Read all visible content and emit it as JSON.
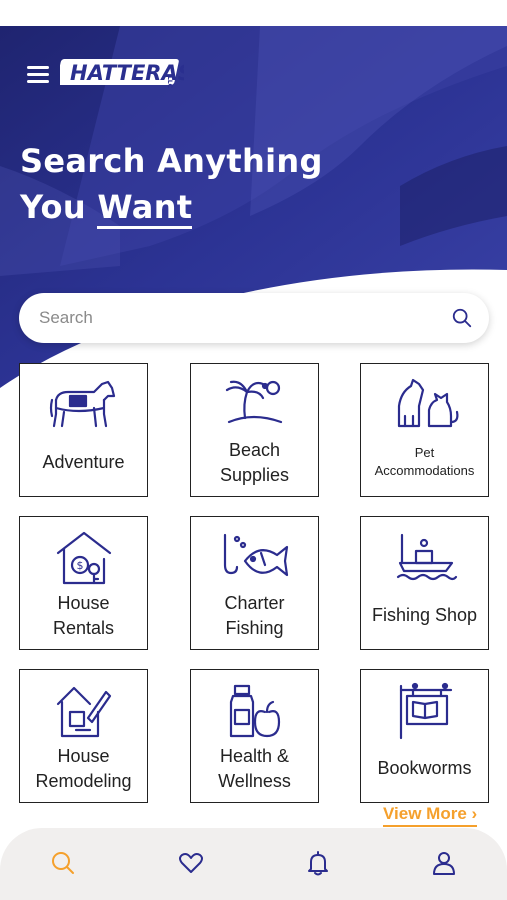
{
  "brand": {
    "logo_text": "HATTERAS",
    "logo_sub": "LLC"
  },
  "hero": {
    "title_line1": "Search Anything",
    "title_line2_a": "You ",
    "title_line2_b": "Want"
  },
  "search": {
    "placeholder": "Search"
  },
  "categories": [
    {
      "label": "Adventure",
      "icon": "horse-icon"
    },
    {
      "label": "Beach\nSupplies",
      "icon": "palm-island-icon"
    },
    {
      "label": "Pet\nAccommodations",
      "icon": "pets-icon"
    },
    {
      "label": "House\nRentals",
      "icon": "house-money-icon"
    },
    {
      "label": "Charter\nFishing",
      "icon": "fish-icon"
    },
    {
      "label": "Fishing Shop",
      "icon": "boat-fishing-icon"
    },
    {
      "label": "House\nRemodeling",
      "icon": "house-tools-icon"
    },
    {
      "label": "Health &\nWellness",
      "icon": "bottle-apple-icon"
    },
    {
      "label": "Bookworms",
      "icon": "book-sign-icon"
    }
  ],
  "view_more": "View More",
  "nav": {
    "items": [
      "search-icon",
      "heart-icon",
      "bell-icon",
      "user-icon"
    ]
  },
  "colors": {
    "hero": "#2a2f8f",
    "accent": "#f5a02c",
    "icon": "#2b2c8e"
  }
}
